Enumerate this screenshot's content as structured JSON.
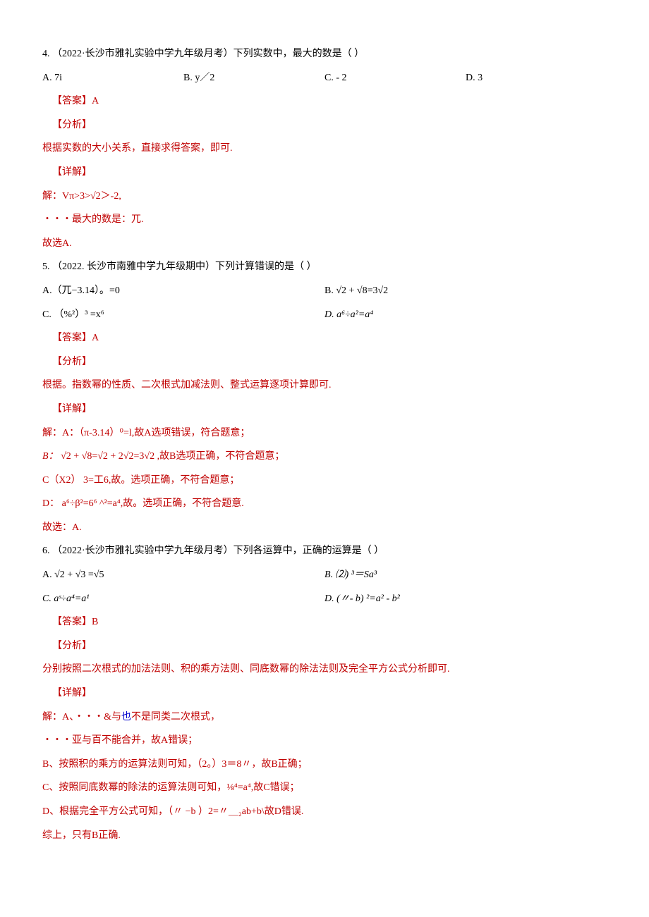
{
  "q4": {
    "stem": "4.   （2022·长沙市雅礼实验中学九年级月考）下列实数中，最大的数是（               ）",
    "A": "A. 7i",
    "B": "B. y／2",
    "C": "C. - 2",
    "D": "D. 3",
    "ans": "【答案】A",
    "fx": "【分析】",
    "fxbody": "根据实数的大小关系，直接求得答案，即可.",
    "xj": "【详解】",
    "sol1": "解：Vπ>3>√2＞-2,",
    "sol2": "・・・最大的数是：兀.",
    "sol3": "故选A."
  },
  "q5": {
    "stem": "5.   （2022. 长沙市南雅中学九年级期中）下列计算错误的是（             ）",
    "A": "A.（兀−3.14）。=0",
    "B": "B. √2 + √8=3√2",
    "C": "C. （%²）³ =x⁶",
    "D": "D. a⁶÷a²=a⁴",
    "ans": "【答案】A",
    "fx": "【分析】",
    "fxbody": "根据。指数幂的性质、二次根式加减法则、整式运算逐项计算即可.",
    "xj": "【详解】",
    "sol1": "解：A：（π-3.14）⁰=l,故A选项错误，符合题意；",
    "sol2_pre": "B：",
    "sol2_body": "√2 + √8=√2 + 2√2=3√2 ,故B选项正确，不符合题意；",
    "sol3": "C（X2） 3=工6,故。选项正确，不符合题意；",
    "sol4": "D：  a⁶÷β²=6⁶ ^²=a⁴,故。选项正确，不符合题意.",
    "sol5": "故选：A."
  },
  "q6": {
    "stem": "6.   （2022·长沙市雅礼实验中学九年级月考）下列各运算中，正确的运算是（                 ）",
    "A": "A. √2 + √3 =√5",
    "B": "B. ⑵)  ³＝Sa³",
    "C": " C. aˢ÷a⁴=a¹",
    "D": "D. (〃- b) ²=a² - b²",
    "ans": "【答案】B",
    "fx": "【分析】",
    "fxbody": "分别按照二次根式的加法法则、积的乘方法则、同底数幂的除法法则及完全平方公式分析即可.",
    "xj": "【详解】",
    "sol1_pre": "解：A、・・・&与",
    "sol1_blue": "也",
    "sol1_post": "不是同类二次根式，",
    "sol2": "・・・亚与百不能合并，故A错误；",
    "sol3": "B、按照积的乘方的运算法则可知，（2。）3＝8〃，故B正确；",
    "sol4": "C、按照同底数幂的除法的运算法则可知，⅛⁴=a⁴,故C错误；",
    "sol5": "D、根据完全平方公式可知，（〃 −b ）2=〃＿₂ab+b\\故D错误.",
    "sol6": "综上，只有B正确."
  }
}
